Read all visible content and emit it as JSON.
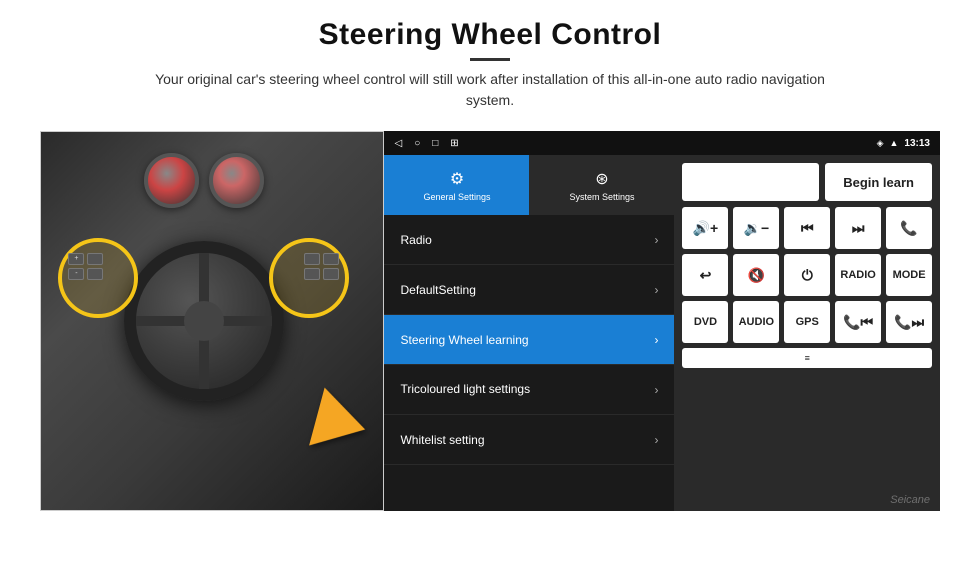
{
  "header": {
    "title": "Steering Wheel Control",
    "subtitle": "Your original car's steering wheel control will still work after installation of this all-in-one auto radio navigation system."
  },
  "status_bar": {
    "time": "13:13",
    "icons": [
      "◁",
      "○",
      "□",
      "⊞"
    ]
  },
  "settings_tabs": [
    {
      "label": "General Settings",
      "active": true
    },
    {
      "label": "System Settings",
      "active": false
    }
  ],
  "menu_items": [
    {
      "label": "Radio",
      "active": false
    },
    {
      "label": "DefaultSetting",
      "active": false
    },
    {
      "label": "Steering Wheel learning",
      "active": true
    },
    {
      "label": "Tricoloured light settings",
      "active": false
    },
    {
      "label": "Whitelist setting",
      "active": false
    }
  ],
  "right_panel": {
    "begin_learn_label": "Begin learn",
    "buttons": {
      "row1": [
        {
          "label": "🔊+",
          "name": "vol-up"
        },
        {
          "label": "🔉-",
          "name": "vol-down"
        },
        {
          "label": "⏮",
          "name": "prev-track"
        },
        {
          "label": "⏭",
          "name": "next-track"
        },
        {
          "label": "📞",
          "name": "call"
        }
      ],
      "row2": [
        {
          "label": "↩",
          "name": "back"
        },
        {
          "label": "🔇",
          "name": "mute"
        },
        {
          "label": "⏻",
          "name": "power"
        },
        {
          "label": "RADIO",
          "name": "radio"
        },
        {
          "label": "MODE",
          "name": "mode"
        }
      ],
      "row3": [
        {
          "label": "DVD",
          "name": "dvd"
        },
        {
          "label": "AUDIO",
          "name": "audio"
        },
        {
          "label": "GPS",
          "name": "gps"
        },
        {
          "label": "📞⏮",
          "name": "call-prev"
        },
        {
          "label": "📞⏭",
          "name": "call-next"
        }
      ]
    }
  },
  "watermark": "Seicane"
}
